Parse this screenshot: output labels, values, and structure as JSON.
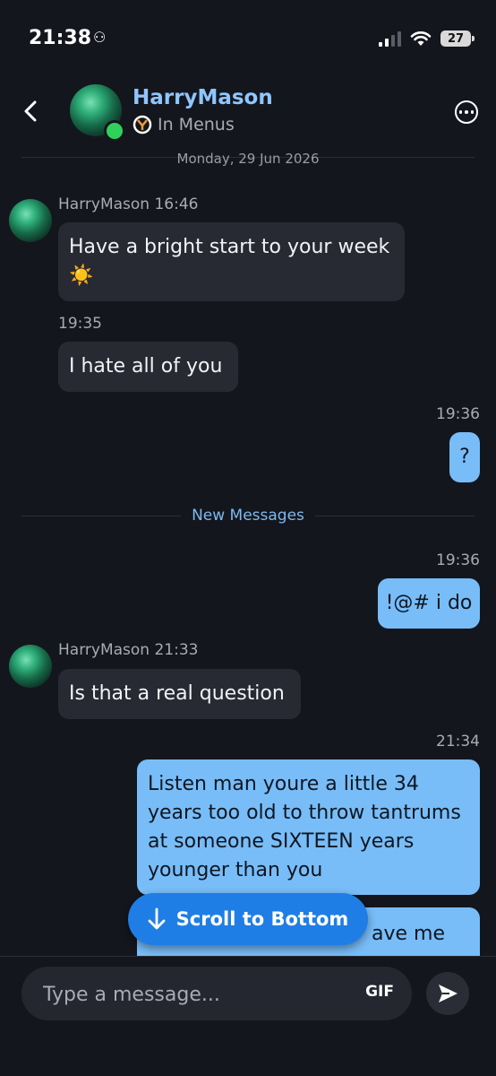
{
  "status_bar": {
    "time": "21:38",
    "battery": "27"
  },
  "header": {
    "name": "HarryMason",
    "status": "In Menus"
  },
  "date_separator": "Monday, 29 Jun 2026",
  "messages": [
    {
      "sender": "HarryMason",
      "time": "16:46",
      "text": "Have a bright start to your week",
      "emoji": "☀️"
    },
    {
      "time": "19:35",
      "text": "I hate all of you"
    },
    {
      "time": "19:36",
      "text": "?"
    },
    {
      "time": "19:36",
      "text": "!@# i do"
    },
    {
      "sender": "HarryMason",
      "time": "21:33",
      "text": "Is that a real question"
    },
    {
      "time": "21:34",
      "lines": [
        "Listen man youre a little 34",
        "years too old to throw tantrums",
        "at someone SIXTEEN years",
        "younger than you"
      ]
    },
    {
      "text_partial": "ave me"
    }
  ],
  "new_messages_label": "New Messages",
  "scroll_button_label": "Scroll to Bottom",
  "composer": {
    "placeholder": "Type a message...",
    "gif_label": "GIF"
  },
  "colors": {
    "accent": "#1f7ee6",
    "outgoing_bubble": "#78bdf8",
    "incoming_bubble": "#272a33",
    "name": "#8fc6ff"
  }
}
